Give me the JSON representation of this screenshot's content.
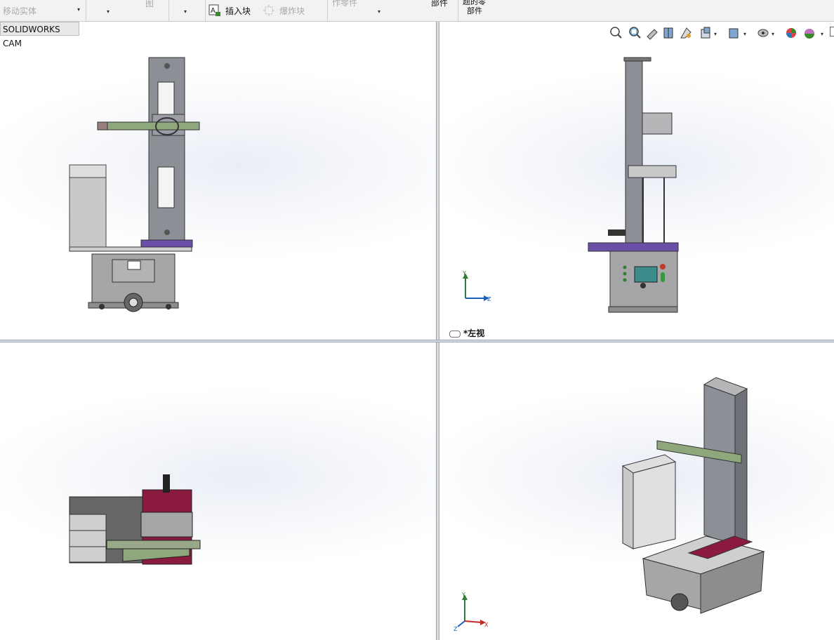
{
  "toolbar": {
    "move_body_label": "移动实体",
    "cropped_label_1": "图",
    "insert_block_label": "插入块",
    "explode_block_label": "爆炸块",
    "cropped_label_2": "作零件",
    "cropped_label_3": "部件",
    "cropped_label_4a": "题的零",
    "cropped_label_4b": "部件"
  },
  "tabs": {
    "cam_label": "SOLIDWORKS CAM"
  },
  "viewports": {
    "top_right_label": "*左视"
  },
  "triad": {
    "y": "Y",
    "z": "Z",
    "x": "X"
  },
  "colors": {
    "frame_gray": "#8d8f96",
    "base_gray": "#a6a6a8",
    "arm_green": "#8fa77c",
    "accent_purple": "#6a4fa8",
    "accent_magenta": "#8a1a3e",
    "screen_teal": "#3c8c8c"
  },
  "icons": [
    "zoom-to-fit-icon",
    "zoom-area-icon",
    "previous-view-icon",
    "section-view-icon",
    "dynamic-annotation-icon",
    "view-orientation-icon",
    "display-style-icon",
    "hide-show-icon",
    "edit-appearance-icon",
    "apply-scene-icon"
  ]
}
